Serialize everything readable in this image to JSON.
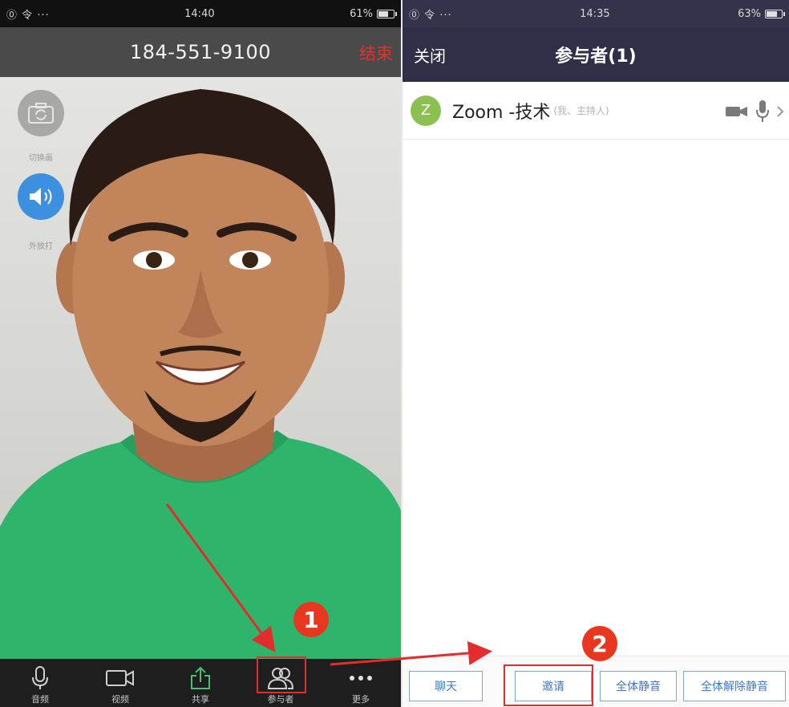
{
  "left_phone": {
    "status": {
      "signal": "⓪ 令 ···",
      "time": "14:40",
      "battery_text": "61%",
      "battery_level": 0.61
    },
    "call": {
      "number": "184-551-9100",
      "end_label": "结束"
    },
    "floating": {
      "switch_camera_label": "切换画",
      "speaker_label": "外放打"
    },
    "toolbar": {
      "items": [
        {
          "label": "音频",
          "icon": "microphone-icon"
        },
        {
          "label": "视频",
          "icon": "video-camera-icon"
        },
        {
          "label": "共享",
          "icon": "share-upload-icon"
        },
        {
          "label": "参与者",
          "icon": "participants-icon"
        },
        {
          "label": "更多",
          "icon": "more-dots-icon"
        }
      ]
    }
  },
  "right_phone": {
    "status": {
      "signal": "⓪ 令 ···",
      "time": "14:35",
      "battery_text": "63%",
      "battery_level": 0.63
    },
    "header": {
      "close_label": "关闭",
      "title": "参与者(1)"
    },
    "participants": [
      {
        "avatar_letter": "Z",
        "name": "Zoom -技术",
        "role": "(我、主持人)",
        "icons": [
          "video-camera-icon",
          "microphone-icon",
          "chevron-right-icon"
        ]
      }
    ],
    "footer": {
      "chat_label": "聊天",
      "invite_label": "邀请",
      "mute_all_label": "全体静音",
      "unmute_all_label": "全体解除静音"
    }
  },
  "annotations": {
    "step1": "1",
    "step2": "2"
  },
  "colors": {
    "accent_red": "#e8371e",
    "header_dark": "#2f3047",
    "avatar_green": "#8cc152",
    "link_blue": "#3f78c6"
  }
}
